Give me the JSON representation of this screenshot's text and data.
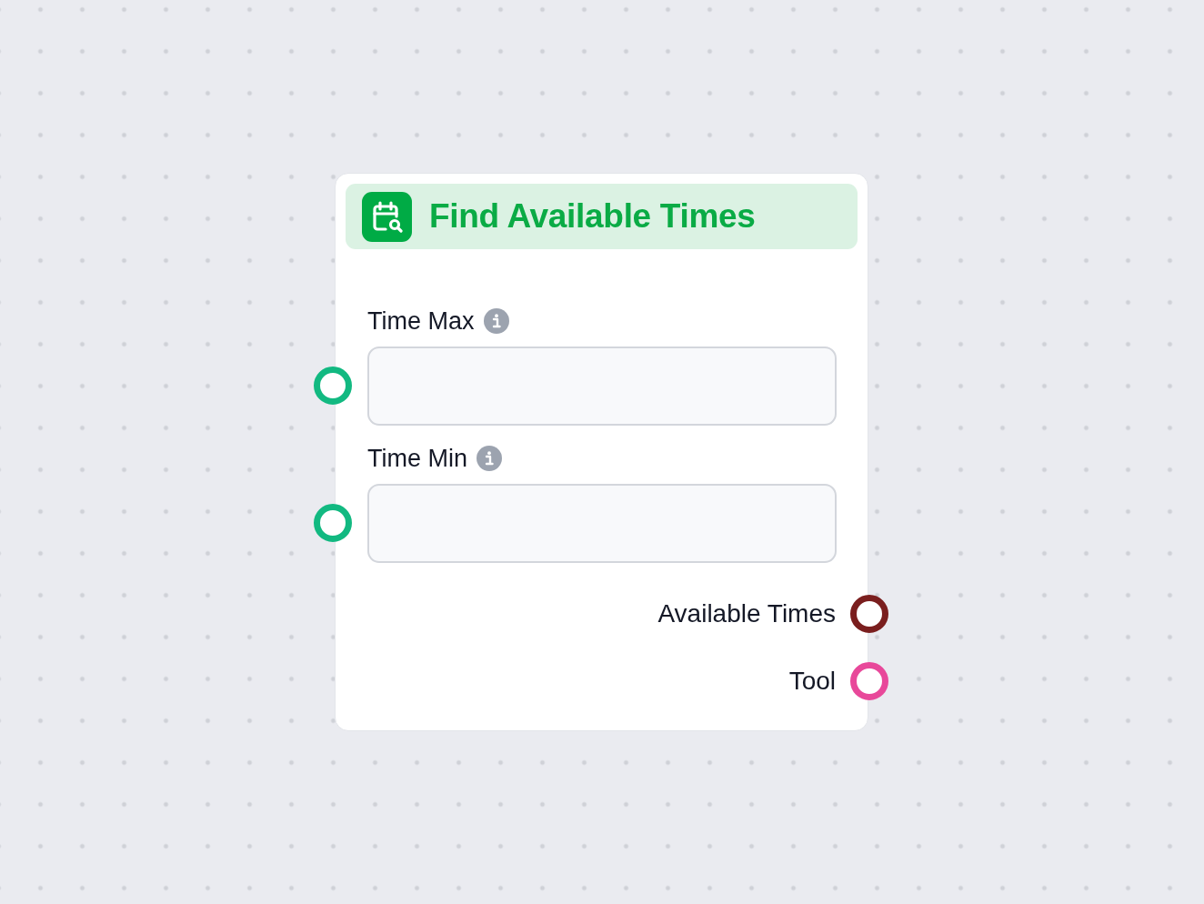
{
  "node": {
    "title": "Find Available Times",
    "inputs": [
      {
        "label": "Time Max",
        "color": "#12b981"
      },
      {
        "label": "Time Min",
        "color": "#12b981"
      }
    ],
    "outputs": [
      {
        "label": "Available Times",
        "color": "#7a1e1e"
      },
      {
        "label": "Tool",
        "color": "#e8489a"
      }
    ]
  }
}
